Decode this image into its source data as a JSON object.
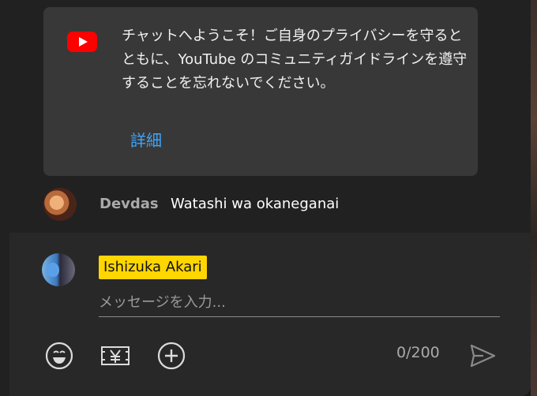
{
  "banner": {
    "text": "チャットへようこそ！ご自身のプライバシーを守るとともに、YouTube のコミュニティガイドラインを遵守することを忘れないでください。",
    "link_label": "詳細"
  },
  "messages": [
    {
      "author": "Devdas",
      "text": "Watashi wa okaneganai"
    }
  ],
  "composer": {
    "username": "Ishizuka Akari",
    "placeholder": "メッセージを入力...",
    "counter": "0/200"
  },
  "colors": {
    "panel_bg": "#212121",
    "banner_bg": "#383838",
    "link": "#3ea6ff",
    "name_chip": "#ffd600",
    "youtube_red": "#ff0000"
  },
  "icons": [
    "youtube-logo-icon",
    "emoji-icon",
    "super-chat-icon",
    "add-icon",
    "send-icon"
  ]
}
